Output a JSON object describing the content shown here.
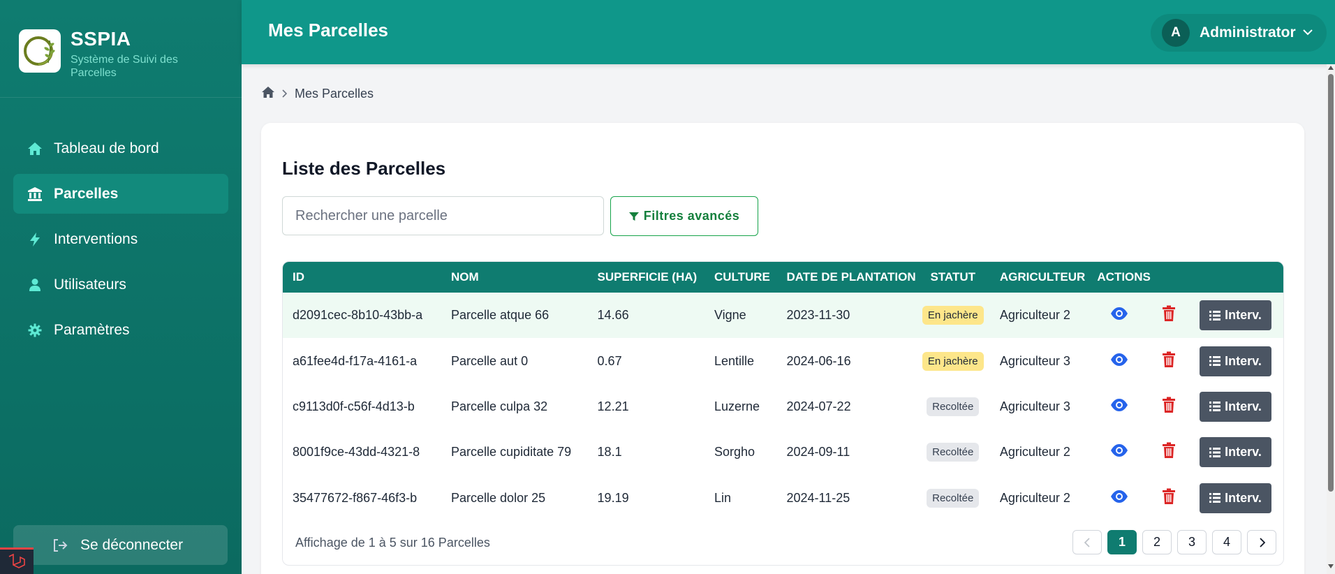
{
  "brand": {
    "title": "SSPIA",
    "subtitle": "Système de Suivi des Parcelles"
  },
  "sidebar": {
    "items": [
      {
        "label": "Tableau de bord",
        "icon": "home-icon"
      },
      {
        "label": "Parcelles",
        "icon": "bank-icon",
        "active": true
      },
      {
        "label": "Interventions",
        "icon": "bolt-icon"
      },
      {
        "label": "Utilisateurs",
        "icon": "user-icon"
      },
      {
        "label": "Paramètres",
        "icon": "gear-icon"
      }
    ],
    "logout_label": "Se déconnecter"
  },
  "header": {
    "title": "Mes Parcelles",
    "user_initial": "A",
    "user_name": "Administrator"
  },
  "breadcrumb": {
    "current": "Mes Parcelles"
  },
  "main": {
    "title": "Liste des Parcelles",
    "search_placeholder": "Rechercher une parcelle",
    "filters_label": "Filtres avancés",
    "interv_label": "Interv.",
    "columns": [
      "ID",
      "NOM",
      "SUPERFICIE (HA)",
      "CULTURE",
      "DATE DE PLANTATION",
      "STATUT",
      "AGRICULTEUR",
      "ACTIONS"
    ],
    "rows": [
      {
        "id": "d2091cec-8b10-43bb-a",
        "nom": "Parcelle atque 66",
        "superficie": "14.66",
        "culture": "Vigne",
        "date": "2023-11-30",
        "statut": "En jachère",
        "agriculteur": "Agriculteur 2"
      },
      {
        "id": "a61fee4d-f17a-4161-a",
        "nom": "Parcelle aut 0",
        "superficie": "0.67",
        "culture": "Lentille",
        "date": "2024-06-16",
        "statut": "En jachère",
        "agriculteur": "Agriculteur 3"
      },
      {
        "id": "c9113d0f-c56f-4d13-b",
        "nom": "Parcelle culpa 32",
        "superficie": "12.21",
        "culture": "Luzerne",
        "date": "2024-07-22",
        "statut": "Recoltée",
        "agriculteur": "Agriculteur 3"
      },
      {
        "id": "8001f9ce-43dd-4321-8",
        "nom": "Parcelle cupiditate 79",
        "superficie": "18.1",
        "culture": "Sorgho",
        "date": "2024-09-11",
        "statut": "Recoltée",
        "agriculteur": "Agriculteur 2"
      },
      {
        "id": "35477672-f867-46f3-b",
        "nom": "Parcelle dolor 25",
        "superficie": "19.19",
        "culture": "Lin",
        "date": "2024-11-25",
        "statut": "Recoltée",
        "agriculteur": "Agriculteur 2"
      }
    ],
    "pagination_info": "Affichage de 1 à 5 sur 16 Parcelles",
    "pages": [
      "1",
      "2",
      "3",
      "4"
    ],
    "current_page": "1"
  },
  "colors": {
    "sidebar": "#0f7c70",
    "header": "#0f978a",
    "accent_green": "#16a34a",
    "status_yellow": "#fde68a",
    "status_gray": "#e5e7eb",
    "view_icon": "#2563eb",
    "delete_icon": "#dc2626"
  }
}
